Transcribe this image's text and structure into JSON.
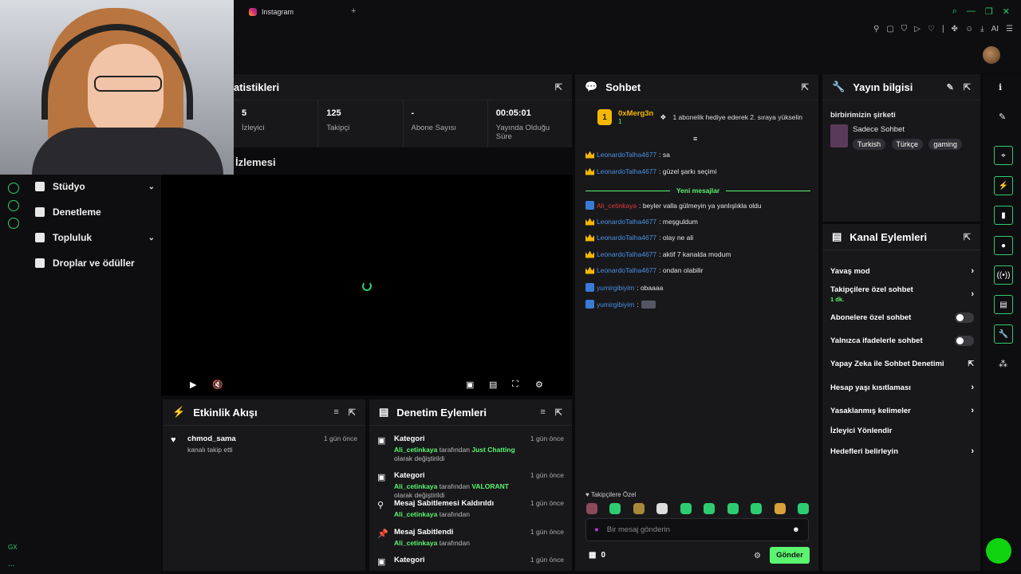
{
  "browser": {
    "tab_title": "Instagram",
    "new_tab": "+",
    "ext_ai": "AI"
  },
  "left_nav": {
    "items": [
      {
        "label": "Stüdyo",
        "has_chevron": true
      },
      {
        "label": "Denetleme",
        "has_chevron": false
      },
      {
        "label": "Topluluk",
        "has_chevron": true
      },
      {
        "label": "Droplar ve ödüller",
        "has_chevron": false
      }
    ],
    "gx": "GX",
    "dots": "..."
  },
  "stats": {
    "title": "atistikleri",
    "cells": [
      {
        "value": "5",
        "label": "İzleyici"
      },
      {
        "value": "125",
        "label": "Takipçi"
      },
      {
        "value": "-",
        "label": "Abone Sayısı"
      },
      {
        "value": "00:05:01",
        "label": "Yayında Olduğu Süre"
      }
    ]
  },
  "preview": {
    "title": "İzlemesi"
  },
  "activity": {
    "title": "Etkinlik Akışı",
    "events": [
      {
        "name": "chmod_sama",
        "desc": "kanalı takip etti",
        "ago": "1 gün önce"
      }
    ]
  },
  "modlog": {
    "title": "Denetim Eylemleri",
    "events": [
      {
        "title": "Kategori",
        "user": "Ali_cetinkaya",
        "mid": " tarafından ",
        "target": "Just Chatting",
        "tail": " olarak değiştirildi",
        "ago": "1 gün önce"
      },
      {
        "title": "Kategori",
        "user": "Ali_cetinkaya",
        "mid": " tarafından ",
        "target": "VALORANT",
        "tail": " olarak değiştirildi",
        "ago": "1 gün önce"
      },
      {
        "title": "Mesaj Sabitlemesi Kaldırıldı",
        "user": "Ali_cetinkaya",
        "mid": " tarafından",
        "target": "",
        "tail": "",
        "ago": "1 gün önce"
      },
      {
        "title": "Mesaj Sabitlendi",
        "user": "Ali_cetinkaya",
        "mid": " tarafından",
        "target": "",
        "tail": "",
        "ago": "1 gün önce"
      },
      {
        "title": "Kategori",
        "user": "",
        "mid": "",
        "target": "",
        "tail": "",
        "ago": "1 gün önce"
      }
    ]
  },
  "chat": {
    "title": "Sohbet",
    "pinned": {
      "rank": "1",
      "name": "0xMerg3n",
      "sub": "1",
      "text": "1 abonelik hediye ederek 2. sıraya yükselin"
    },
    "messages_before": [
      {
        "user": "LeonardoTalha4677",
        "text": ": sa",
        "badge": "crown",
        "color": "#4a90e2"
      },
      {
        "user": "LeonardoTalha4677",
        "text": ": güzel şarkı seçimi",
        "badge": "crown",
        "color": "#4a90e2"
      }
    ],
    "new_label": "Yeni mesajlar",
    "messages_after": [
      {
        "user": "Ali_cetinkaya",
        "text": ": beyler valla gülmeyin ya yanlışlıkla oldu",
        "badge": "sword",
        "color": "#e03a3a"
      },
      {
        "user": "LeonardoTalha4677",
        "text": ": meşguldum",
        "badge": "crown",
        "color": "#4a90e2"
      },
      {
        "user": "LeonardoTalha4677",
        "text": ": olay ne ali",
        "badge": "crown",
        "color": "#4a90e2"
      },
      {
        "user": "LeonardoTalha4677",
        "text": ": aktif 7 kanalda modum",
        "badge": "crown",
        "color": "#4a90e2"
      },
      {
        "user": "LeonardoTalha4677",
        "text": ": ondan olabilir",
        "badge": "crown",
        "color": "#4a90e2"
      },
      {
        "user": "yumirgibiyim",
        "text": ": obaaaa",
        "badge": "sword",
        "color": "#4a90e2"
      },
      {
        "user": "yumirgibiyim",
        "text": ":",
        "badge": "sword",
        "color": "#4a90e2"
      }
    ],
    "followers_only_label": "Takipçilere Özel",
    "input_placeholder": "Bir mesaj gönderin",
    "points": "0",
    "send_label": "Gönder"
  },
  "stream_info": {
    "title": "Yayın bilgisi",
    "stream_title": "birbirimizin şirketi",
    "category": "Sadece Sohbet",
    "tags": [
      "Turkish",
      "Türkçe",
      "gaming"
    ]
  },
  "channel_actions": {
    "title": "Kanal Eylemleri",
    "items": [
      {
        "label": "Yavaş mod",
        "control": "chevron",
        "sub": ""
      },
      {
        "label": "Takipçilere özel sohbet",
        "control": "chevron",
        "sub": "1 dk."
      },
      {
        "label": "Abonelere özel sohbet",
        "control": "toggle",
        "sub": ""
      },
      {
        "label": "Yalnızca ifadelerle sohbet",
        "control": "toggle",
        "sub": ""
      },
      {
        "label": "Yapay Zeka ile Sohbet Denetimi",
        "control": "external",
        "sub": ""
      },
      {
        "label": "Hesap yaşı kısıtlaması",
        "control": "chevron",
        "sub": ""
      },
      {
        "label": "Yasaklanmış kelimeler",
        "control": "chevron",
        "sub": ""
      },
      {
        "label": "İzleyici Yönlendir",
        "control": "none",
        "sub": ""
      },
      {
        "label": "Hedefleri belirleyin",
        "control": "chevron",
        "sub": ""
      }
    ]
  },
  "colors": {
    "accent": "#5bf56f",
    "panel": "#18181b",
    "bg": "#0b0b0d",
    "crown": "#f5b800"
  }
}
